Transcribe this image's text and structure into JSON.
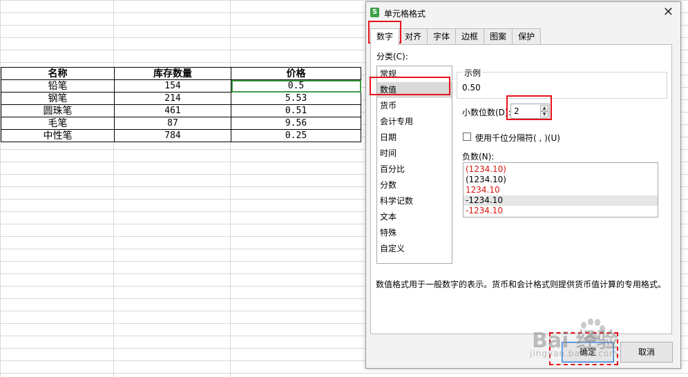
{
  "spreadsheet": {
    "headers": [
      "名称",
      "库存数量",
      "价格"
    ],
    "rows": [
      [
        "铅笔",
        "154",
        "0.5"
      ],
      [
        "钢笔",
        "214",
        "5.53"
      ],
      [
        "圆珠笔",
        "461",
        "0.51"
      ],
      [
        "毛笔",
        "87",
        "9.56"
      ],
      [
        "中性笔",
        "784",
        "0.25"
      ]
    ]
  },
  "dialog": {
    "app_icon": "S",
    "title": "单元格格式",
    "close_glyph": "✕",
    "tabs": [
      "数字",
      "对齐",
      "字体",
      "边框",
      "图案",
      "保护"
    ],
    "category_label": "分类(C):",
    "categories": [
      "常规",
      "数值",
      "货币",
      "会计专用",
      "日期",
      "时间",
      "百分比",
      "分数",
      "科学记数",
      "文本",
      "特殊",
      "自定义"
    ],
    "selected_category": "数值",
    "sample_label": "示例",
    "sample_value": "0.50",
    "decimal_label": "小数位数(D):",
    "decimal_value": "2",
    "thousands_label": "使用千位分隔符( , )(U)",
    "negative_label": "负数(N):",
    "negative_options": [
      {
        "text": "(1234.10)",
        "red": true
      },
      {
        "text": "(1234.10)",
        "red": false
      },
      {
        "text": "1234.10",
        "red": true
      },
      {
        "text": "-1234.10",
        "red": false,
        "selected": true
      },
      {
        "text": "-1234.10",
        "red": true
      }
    ],
    "description": "数值格式用于一般数字的表示。货币和会计格式则提供货币值计算的专用格式。",
    "ok_label": "确定",
    "cancel_label": "取消"
  },
  "watermark": {
    "text": "Bai 经验",
    "sub": "jingyan.baidu.com"
  },
  "colors": {
    "highlight_red": "#e8111a",
    "selection_green": "#3f9c47",
    "negative_red": "#d9150d"
  }
}
